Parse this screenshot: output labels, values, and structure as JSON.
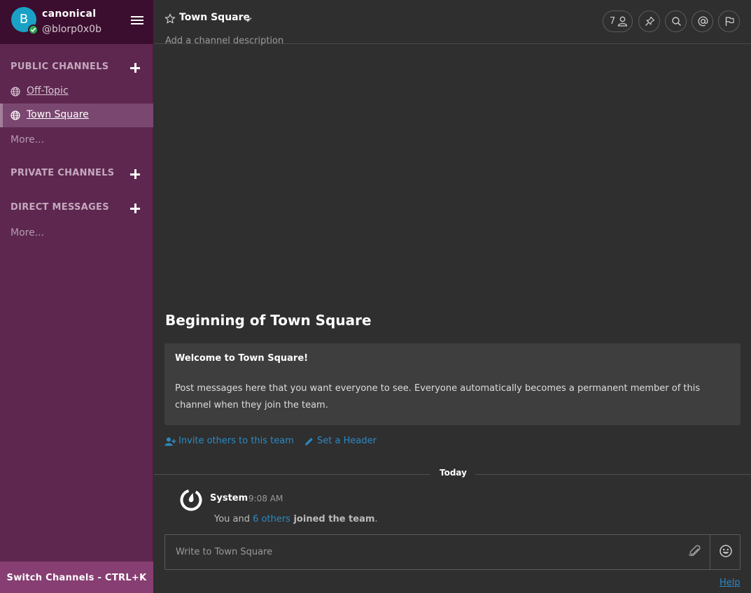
{
  "team": {
    "avatar_letter": "B",
    "name": "canonical",
    "username": "@blorp0x0b"
  },
  "sidebar": {
    "public_channels_title": "PUBLIC CHANNELS",
    "public_channels": [
      {
        "label": "Off-Topic",
        "active": false
      },
      {
        "label": "Town Square",
        "active": true
      }
    ],
    "public_more": "More...",
    "private_channels_title": "PRIVATE CHANNELS",
    "direct_messages_title": "DIRECT MESSAGES",
    "direct_more": "More...",
    "switch_channels": "Switch Channels - CTRL+K"
  },
  "header": {
    "channel_name": "Town Square",
    "description_placeholder": "Add a channel description",
    "member_count": "7",
    "icons": [
      "star-icon",
      "chevron-down-icon",
      "member-icon",
      "pin-icon",
      "search-icon",
      "mention-icon",
      "flag-icon"
    ]
  },
  "intro": {
    "title": "Beginning of Town Square",
    "welcome_title": "Welcome to Town Square!",
    "welcome_text": "Post messages here that you want everyone to see. Everyone automatically becomes a permanent member of this channel when they join the team.",
    "invite_link": "Invite others to this team",
    "header_link": "Set a Header"
  },
  "date_separator": "Today",
  "post": {
    "author": "System",
    "time": "9:08 AM",
    "body_prefix": "You and ",
    "body_link": "6 others",
    "body_suffix": " joined the team",
    "body_end": "."
  },
  "composer": {
    "placeholder": "Write to Town Square"
  },
  "help": "Help",
  "colors": {
    "sidebar_bg": "#5e2750",
    "sidebar_header_bg": "#3b0e2f",
    "active_channel_bg": "#7a4770",
    "switch_bar_bg": "#873e72",
    "main_bg": "#2f2f2f",
    "link": "#2b8ac4",
    "avatar": "#19a1c6",
    "online": "#2fa84f"
  }
}
